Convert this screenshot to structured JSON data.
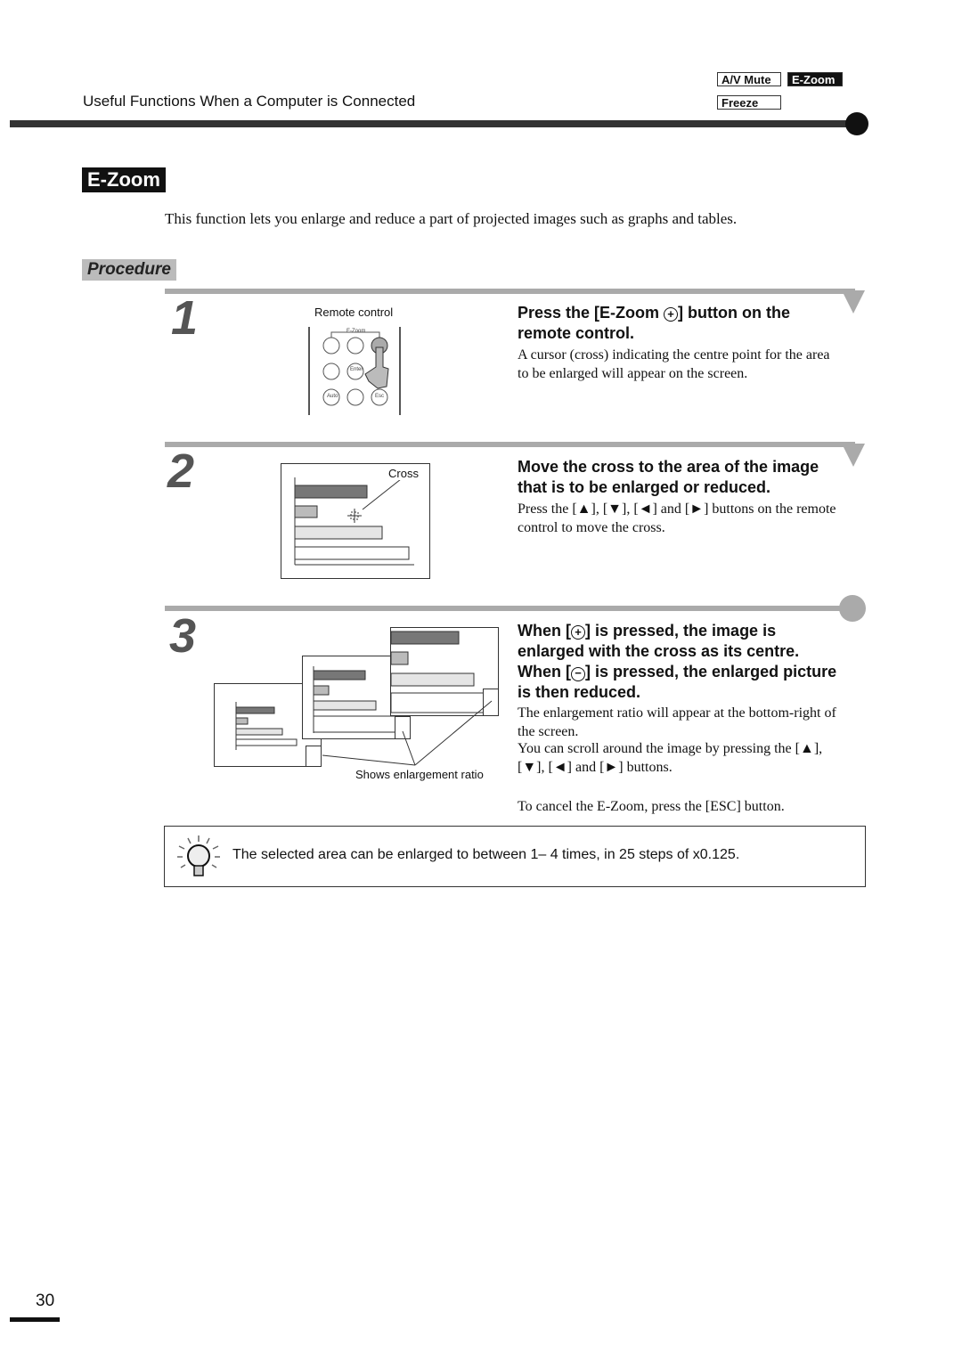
{
  "header": {
    "section": "Useful Functions When a Computer is Connected",
    "tags": [
      {
        "label": "A/V Mute",
        "active": false
      },
      {
        "label": "E-Zoom",
        "active": true
      },
      {
        "label": "Freeze",
        "active": false
      }
    ]
  },
  "title": "E-Zoom",
  "intro": "This function lets you enlarge and reduce a part of projected images such as graphs and tables.",
  "procedure_label": "Procedure",
  "steps": [
    {
      "number": "1",
      "figure_label": "Remote control",
      "remote": {
        "ezoom": "E-Zoom",
        "enter": "Enter",
        "auto": "Auto",
        "esc": "Esc"
      },
      "heading_a": "Press the [E-Zoom ",
      "heading_b": "] button on the remote control.",
      "body": "A cursor (cross) indicating the centre point for the area to be enlarged will appear on the screen."
    },
    {
      "number": "2",
      "figure_label": "Cross",
      "heading": "Move the cross to the area of the image that is to be enlarged or reduced.",
      "body": "Press the [▲], [▼], [◄] and [►] buttons on the remote control to move the cross."
    },
    {
      "number": "3",
      "figure_label": "Shows enlargement ratio",
      "heading_1a": "When [",
      "heading_1b": "] is pressed, the image is enlarged with the cross as its centre.",
      "heading_2a": "When [",
      "heading_2b": "] is pressed, the enlarged picture is then reduced.",
      "body_1": "The enlargement ratio will appear at the bottom-right of the screen.",
      "body_2": "You can scroll around the image by pressing the [▲], [▼], [◄] and [►] buttons.",
      "body_3": "To cancel the E-Zoom, press the [ESC] button."
    }
  ],
  "tip": {
    "icon": "lightbulb-icon",
    "text": "The selected area can be enlarged to between 1– 4 times, in 25 steps of x0.125."
  },
  "page_number": "30"
}
